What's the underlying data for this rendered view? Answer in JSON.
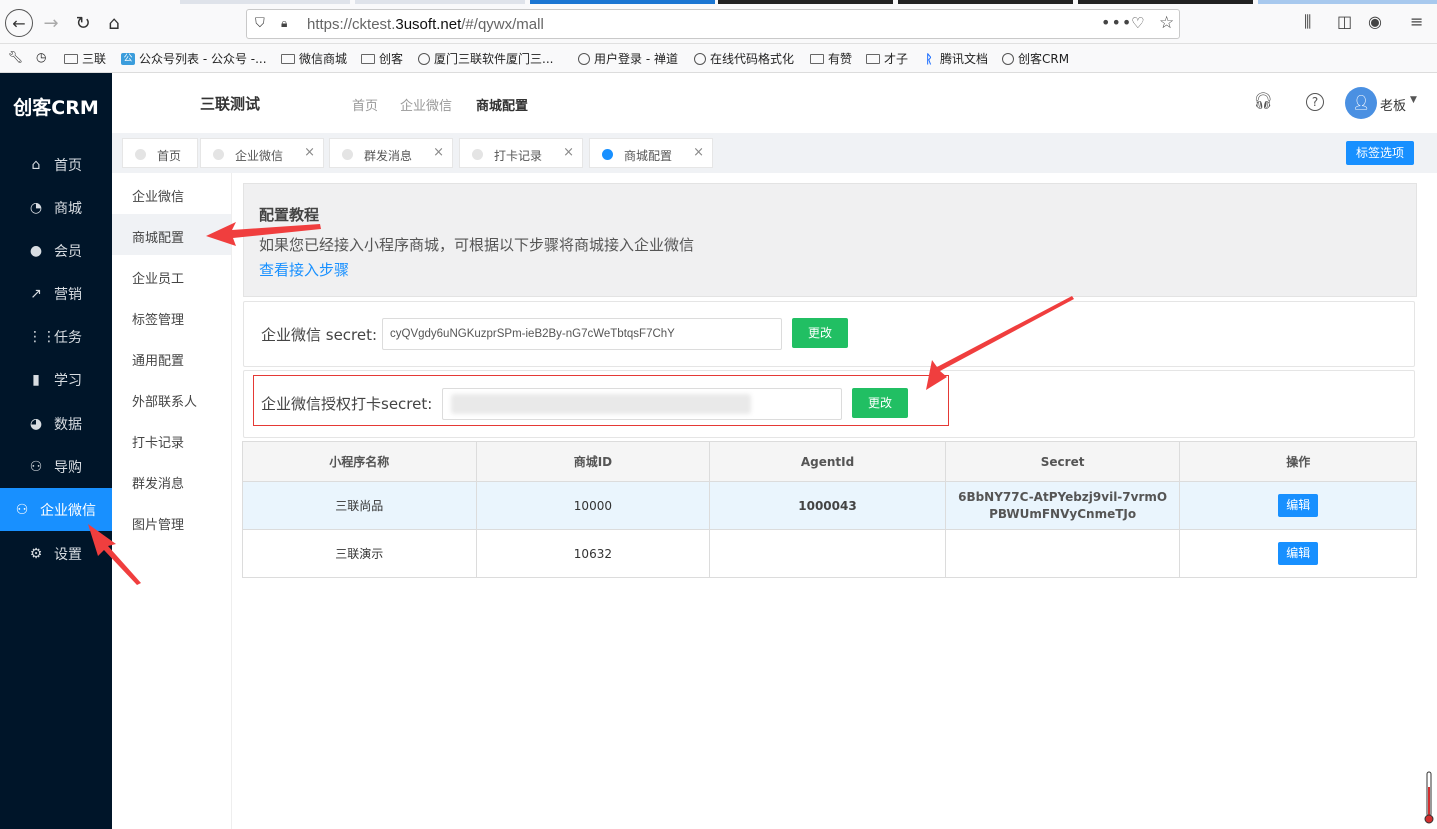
{
  "browser": {
    "url_prefix": "https://cktest.",
    "url_host": "3usoft.net",
    "url_path": "/#/qywx/mall",
    "more_icon": "more-horizontal-icon",
    "bookmarks": [
      {
        "label": "三联",
        "icon": "folder-icon"
      },
      {
        "label": "公众号列表 - 公众号 -...",
        "icon": "wechat-icon"
      },
      {
        "label": "微信商城",
        "icon": "folder-icon"
      },
      {
        "label": "创客",
        "icon": "folder-icon"
      },
      {
        "label": "厦门三联软件厦门三...",
        "icon": "globe-icon"
      },
      {
        "label": "用户登录 - 禅道",
        "icon": "globe-icon"
      },
      {
        "label": "在线代码格式化",
        "icon": "globe-icon"
      },
      {
        "label": "有赞",
        "icon": "folder-icon"
      },
      {
        "label": "才子",
        "icon": "folder-icon"
      },
      {
        "label": "腾讯文档",
        "icon": "tencent-docs-icon"
      },
      {
        "label": "创客CRM",
        "icon": "globe-icon"
      }
    ]
  },
  "app": {
    "logo": "创客CRM",
    "sidebar": [
      {
        "label": "首页",
        "icon": "home-icon",
        "glyph": "⌂"
      },
      {
        "label": "商城",
        "icon": "shop-icon",
        "glyph": "◔"
      },
      {
        "label": "会员",
        "icon": "user-icon",
        "glyph": "●"
      },
      {
        "label": "营销",
        "icon": "trend-icon",
        "glyph": "↗"
      },
      {
        "label": "任务",
        "icon": "grid-icon",
        "glyph": "⋮⋮"
      },
      {
        "label": "学习",
        "icon": "book-icon",
        "glyph": "▮"
      },
      {
        "label": "数据",
        "icon": "pie-icon",
        "glyph": "◕"
      },
      {
        "label": "导购",
        "icon": "team-icon",
        "glyph": "⚇"
      },
      {
        "label": "企业微信",
        "icon": "team-icon",
        "glyph": "⚇",
        "active": true
      },
      {
        "label": "设置",
        "icon": "gear-icon",
        "glyph": "⚙"
      }
    ],
    "header": {
      "title": "三联测试",
      "nav": [
        "首页",
        "企业微信",
        "商城配置"
      ],
      "user": "老板"
    },
    "tabs": [
      {
        "label": "首页",
        "closable": false
      },
      {
        "label": "企业微信",
        "closable": true
      },
      {
        "label": "群发消息",
        "closable": true
      },
      {
        "label": "打卡记录",
        "closable": true
      },
      {
        "label": "商城配置",
        "closable": true,
        "active": true
      }
    ],
    "tag_options_label": "标签选项",
    "submenu": [
      "企业微信",
      "商城配置",
      "企业员工",
      "标签管理",
      "通用配置",
      "外部联系人",
      "打卡记录",
      "群发消息",
      "图片管理"
    ],
    "tutorial": {
      "title": "配置教程",
      "desc": "如果您已经接入小程序商城，可根据以下步骤将商城接入企业微信",
      "link": "查看接入步骤"
    },
    "secret_form": {
      "label": "企业微信 secret:",
      "value": "cyQVgdy6uNGKuzprSPm-ieB2By-nG7cWeTbtqsF7ChY",
      "button": "更改"
    },
    "checkin_form": {
      "label": "企业微信授权打卡secret:",
      "button": "更改"
    },
    "table": {
      "headers": [
        "小程序名称",
        "商城ID",
        "AgentId",
        "Secret",
        "操作"
      ],
      "rows": [
        {
          "name": "三联尚品",
          "mall_id": "10000",
          "agent_id": "1000043",
          "secret": "6BbNY77C-AtPYebzj9vil-7vrmOPBWUmFNVyCnmeTJo",
          "action": "编辑"
        },
        {
          "name": "三联演示",
          "mall_id": "10632",
          "agent_id": "",
          "secret": "",
          "action": "编辑"
        }
      ]
    }
  },
  "colors": {
    "sidebar_bg": "#001529",
    "accent": "#1890ff",
    "green": "#21bf63",
    "annotation_red": "#e53935"
  }
}
